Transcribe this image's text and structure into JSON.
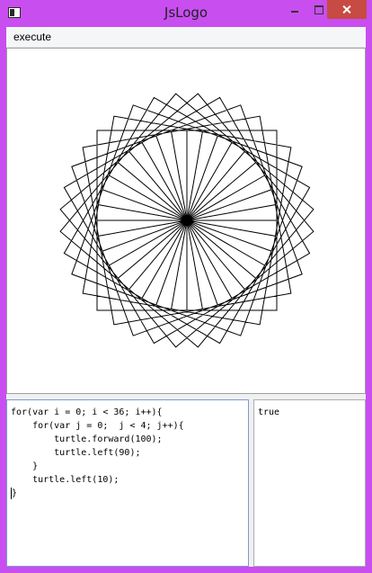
{
  "window": {
    "title": "JsLogo",
    "accent_color": "#c84ef0",
    "close_color": "#c74a43",
    "icons": [
      "app-icon",
      "minimize-icon",
      "maximize-icon",
      "close-icon"
    ]
  },
  "menu": {
    "items": [
      {
        "label": "execute"
      }
    ]
  },
  "canvas": {
    "background": "#ffffff",
    "stroke_color": "#000000",
    "drawing": {
      "outer_loop_count": 36,
      "inner_loop_count": 4,
      "forward_distance": 100,
      "inner_turn_degrees": 90,
      "outer_turn_degrees": 10
    }
  },
  "editor": {
    "lines": [
      "for(var i = 0; i < 36; i++){",
      "    for(var j = 0;  j < 4; j++){",
      "        turtle.forward(100);",
      "        turtle.left(90);",
      "    }",
      "    turtle.left(10);",
      "}"
    ]
  },
  "output": {
    "text": "true"
  }
}
